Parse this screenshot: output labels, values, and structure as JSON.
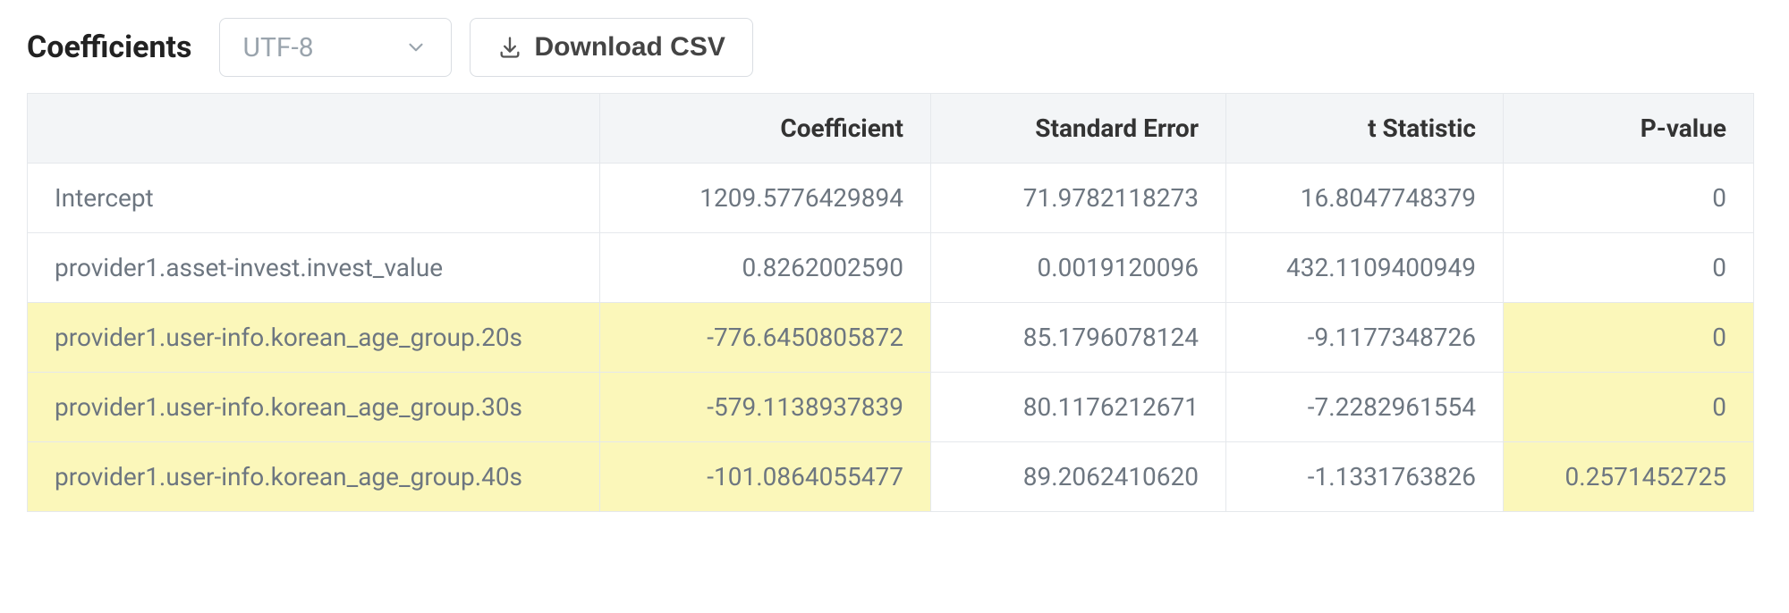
{
  "header": {
    "title": "Coefficients",
    "encoding_select": {
      "value": "UTF-8"
    },
    "download_label": "Download CSV"
  },
  "table": {
    "columns": [
      "",
      "Coefficient",
      "Standard Error",
      "t Statistic",
      "P-value"
    ],
    "rows": [
      {
        "name": "Intercept",
        "coef": "1209.5776429894",
        "se": "71.9782118273",
        "t": "16.8047748379",
        "p": "0",
        "hl_name": false,
        "hl_p": false
      },
      {
        "name": "provider1.asset-invest.invest_value",
        "coef": "0.8262002590",
        "se": "0.0019120096",
        "t": "432.1109400949",
        "p": "0",
        "hl_name": false,
        "hl_p": false
      },
      {
        "name": "provider1.user-info.korean_age_group.20s",
        "coef": "-776.6450805872",
        "se": "85.1796078124",
        "t": "-9.1177348726",
        "p": "0",
        "hl_name": true,
        "hl_p": true
      },
      {
        "name": "provider1.user-info.korean_age_group.30s",
        "coef": "-579.1138937839",
        "se": "80.1176212671",
        "t": "-7.2282961554",
        "p": "0",
        "hl_name": true,
        "hl_p": true
      },
      {
        "name": "provider1.user-info.korean_age_group.40s",
        "coef": "-101.0864055477",
        "se": "89.2062410620",
        "t": "-1.1331763826",
        "p": "0.2571452725",
        "hl_name": true,
        "hl_p": true
      }
    ]
  }
}
